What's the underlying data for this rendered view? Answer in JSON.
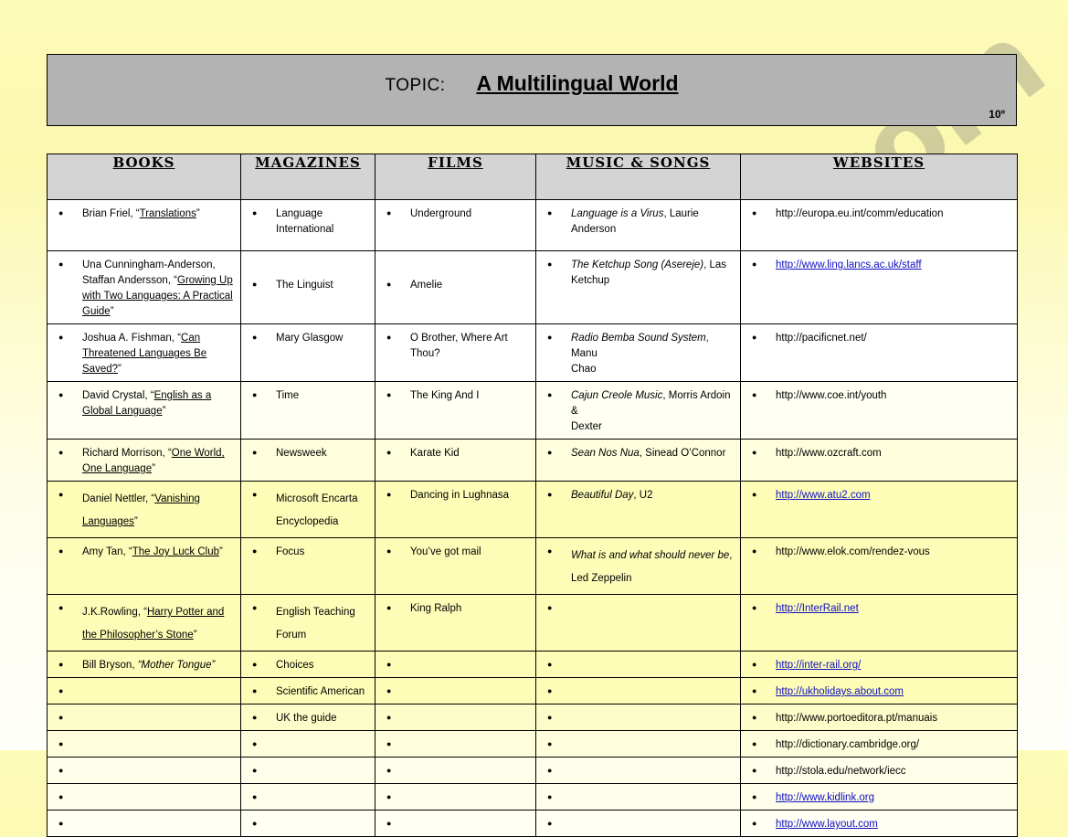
{
  "header": {
    "topic_label": "TOPIC:",
    "topic_value": "A Multilingual World",
    "grade": "10º"
  },
  "watermark": {
    "text": "ESLprintables.com"
  },
  "table": {
    "columns": [
      {
        "label": "BOOKS",
        "name": "books"
      },
      {
        "label": "MAGAZINES",
        "name": "magazines"
      },
      {
        "label": "FILMS",
        "name": "films"
      },
      {
        "label": "MUSIC & SONGS",
        "name": "music-and-songs"
      },
      {
        "label": "WEBSITES",
        "name": "websites"
      }
    ],
    "rows": [
      {
        "height": 56,
        "shade": "shade-w",
        "books": {
          "html": "Brian Friel, &ldquo;<span class=\"u\">Translations</span>&rdquo;"
        },
        "magazines": {
          "html": "Language<br>International"
        },
        "films": {
          "html": "Underground"
        },
        "music": {
          "html": "<span class=\"i\">Language is a Virus</span>, Laurie<br>Anderson"
        },
        "websites": {
          "html": "http://europa.eu.int/comm/education"
        }
      },
      {
        "height": 62,
        "shade": "shade-w",
        "books": {
          "html": "Una Cunningham-Anderson,<br>Staffan Andersson, &ldquo;<span class=\"u\">Growing Up</span><br><span class=\"u\">with Two Languages: A Practical</span><br><span class=\"u\">Guide</span>&rdquo;"
        },
        "magazines": {
          "html": "The Linguist",
          "offset": 22
        },
        "films": {
          "html": "Amelie",
          "offset": 22
        },
        "music": {
          "html": "<span class=\"i\">The Ketchup Song (Asereje)</span>, Las<br>Ketchup"
        },
        "websites": {
          "html": "<span class=\"lnk\">http://www.ling.lancs.ac.uk/staff</span>"
        }
      },
      {
        "height": 52,
        "shade": "shade-w",
        "books": {
          "html": "Joshua A. Fishman, &ldquo;<span class=\"u\">Can</span><br><span class=\"u\">Threatened Languages Be</span><br><span class=\"u\">Saved?</span>&rdquo;"
        },
        "magazines": {
          "html": "Mary Glasgow"
        },
        "films": {
          "html": "O Brother, Where Art<br>Thou?"
        },
        "music": {
          "html": "<span class=\"i\">Radio Bemba Sound System</span>, Manu<br>Chao"
        },
        "websites": {
          "html": "http://pacificnet.net/"
        }
      },
      {
        "height": 35,
        "shade": "shade-y5",
        "books": {
          "html": "David Crystal, &ldquo;<span class=\"u\">English as a</span><br><span class=\"u\">Global Language</span>&rdquo;"
        },
        "magazines": {
          "html": "Time"
        },
        "films": {
          "html": "The King And I"
        },
        "music": {
          "html": "<span class=\"i\">Cajun Creole Music</span>, Morris Ardoin &amp;<br>Dexter"
        },
        "websites": {
          "html": "http://www.coe.int/youth"
        }
      },
      {
        "height": 35,
        "shade": "shade-y3",
        "books": {
          "html": "Richard Morrison, &ldquo;<span class=\"u\">One World,</span><br><span class=\"u\">One Language</span>&rdquo;"
        },
        "magazines": {
          "html": "Newsweek"
        },
        "films": {
          "html": "Karate Kid"
        },
        "music": {
          "html": "<span class=\"i\">Sean Nos Nua</span>, Sinead O&rsquo;Connor"
        },
        "websites": {
          "html": "http://www.ozcraft.com"
        }
      },
      {
        "height": 48,
        "shade": "shade-y2",
        "books": {
          "html": "Daniel Nettler, &ldquo;<span class=\"u\">Vanishing</span><br><span class=\"u\">Languages</span>&rdquo;",
          "loose": true
        },
        "magazines": {
          "html": "Microsoft Encarta<br>Encyclopedia",
          "loose": true
        },
        "films": {
          "html": "Dancing in Lughnasa"
        },
        "music": {
          "html": "<span class=\"i\">Beautiful Day</span>, U2"
        },
        "websites": {
          "html": "<span class=\"lnk\">http://www.atu2.com</span>"
        }
      },
      {
        "height": 51,
        "shade": "shade-y2",
        "books": {
          "html": "Amy Tan, &ldquo;<span class=\"u\">The Joy Luck Club</span>&rdquo;"
        },
        "magazines": {
          "html": "Focus"
        },
        "films": {
          "html": "You&rsquo;ve got mail"
        },
        "music": {
          "html": "<span class=\"i\">What is and what should never be</span>,<br>Led Zeppelin",
          "loose": true
        },
        "websites": {
          "html": "http://www.elok.com/rendez-vous"
        }
      },
      {
        "height": 50,
        "shade": "shade-y2",
        "books": {
          "html": "J.K.Rowling, &ldquo;<span class=\"u\">Harry Potter and</span><br><span class=\"u\">the Philosopher&rsquo;s Stone</span>&rdquo;",
          "loose": true
        },
        "magazines": {
          "html": "English Teaching<br>Forum",
          "loose": true
        },
        "films": {
          "html": "King Ralph"
        },
        "music": {
          "html": ""
        },
        "websites": {
          "html": "<span class=\"lnk\">http://InterRail.net</span>"
        }
      },
      {
        "height": 26,
        "shade": "shade-y2",
        "books": {
          "html": "Bill Bryson, <span class=\"i\">&ldquo;Mother Tongue&rdquo;</span>"
        },
        "magazines": {
          "html": "Choices"
        },
        "films": {
          "html": ""
        },
        "music": {
          "html": ""
        },
        "websites": {
          "html": "<span class=\"lnk\">http://inter-rail.org/</span>"
        }
      },
      {
        "height": 26,
        "shade": "shade-y2",
        "books": {
          "html": ""
        },
        "magazines": {
          "html": "Scientific American"
        },
        "films": {
          "html": ""
        },
        "music": {
          "html": ""
        },
        "websites": {
          "html": "<span class=\"lnk\">http://ukholidays.about.com</span>"
        }
      },
      {
        "height": 26,
        "shade": "shade-y1",
        "books": {
          "html": ""
        },
        "magazines": {
          "html": "UK the guide"
        },
        "films": {
          "html": ""
        },
        "music": {
          "html": ""
        },
        "websites": {
          "html": "http://www.portoeditora.pt/manuais"
        }
      },
      {
        "height": 26,
        "shade": "shade-y3",
        "books": {
          "html": ""
        },
        "magazines": {
          "html": ""
        },
        "films": {
          "html": ""
        },
        "music": {
          "html": ""
        },
        "websites": {
          "html": "http://dictionary.cambridge.org/"
        }
      },
      {
        "height": 26,
        "shade": "shade-y4",
        "books": {
          "html": ""
        },
        "magazines": {
          "html": ""
        },
        "films": {
          "html": ""
        },
        "music": {
          "html": ""
        },
        "websites": {
          "html": "http://stola.edu/network/iecc"
        }
      },
      {
        "height": 26,
        "shade": "shade-y4",
        "books": {
          "html": ""
        },
        "magazines": {
          "html": ""
        },
        "films": {
          "html": ""
        },
        "music": {
          "html": ""
        },
        "websites": {
          "html": "<span class=\"lnk\">http://www.kidlink.org</span>"
        }
      },
      {
        "height": 26,
        "shade": "shade-y5",
        "books": {
          "html": ""
        },
        "magazines": {
          "html": ""
        },
        "films": {
          "html": ""
        },
        "music": {
          "html": ""
        },
        "websites": {
          "html": "<span class=\"lnk\">http://www.layout.com</span>"
        }
      }
    ]
  },
  "colors": {
    "page_background_top": "#fcfbb8",
    "page_background_bottom": "#fffffa",
    "topic_box": "#b3b3b3",
    "table_header": "#d4d4d4",
    "link": "#1010c0",
    "watermark": "#696969"
  }
}
